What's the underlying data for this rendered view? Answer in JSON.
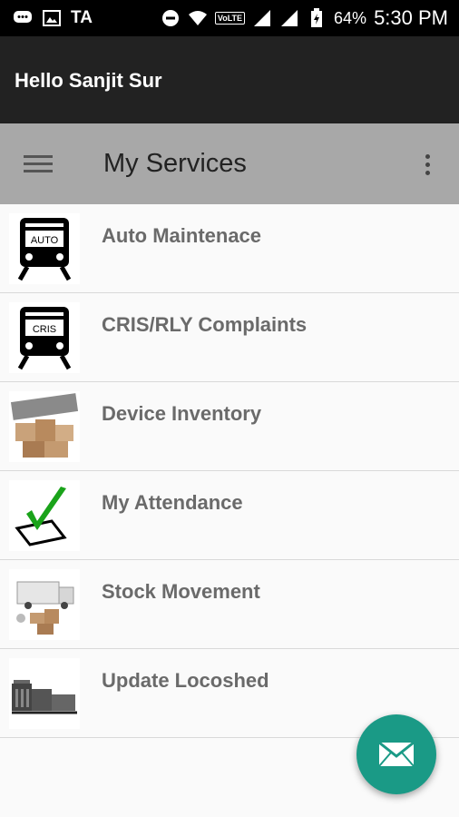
{
  "status_bar": {
    "carrier": "TA",
    "battery": "64%",
    "time": "5:30 PM",
    "network": "VoLTE"
  },
  "header": {
    "greeting": "Hello Sanjit Sur"
  },
  "toolbar": {
    "title": "My Services"
  },
  "services": [
    {
      "label": "Auto Maintenace",
      "icon": "train-auto-icon",
      "badge": "AUTO"
    },
    {
      "label": "CRIS/RLY Complaints",
      "icon": "train-cris-icon",
      "badge": "CRIS"
    },
    {
      "label": "Device Inventory",
      "icon": "inventory-boxes-icon"
    },
    {
      "label": "My Attendance",
      "icon": "checkmark-icon"
    },
    {
      "label": "Stock Movement",
      "icon": "stock-truck-icon"
    },
    {
      "label": "Update Locoshed",
      "icon": "locoshed-icon"
    }
  ],
  "colors": {
    "accent": "#1a9a86",
    "toolbar": "#a8a8a8",
    "header": "#222222"
  }
}
